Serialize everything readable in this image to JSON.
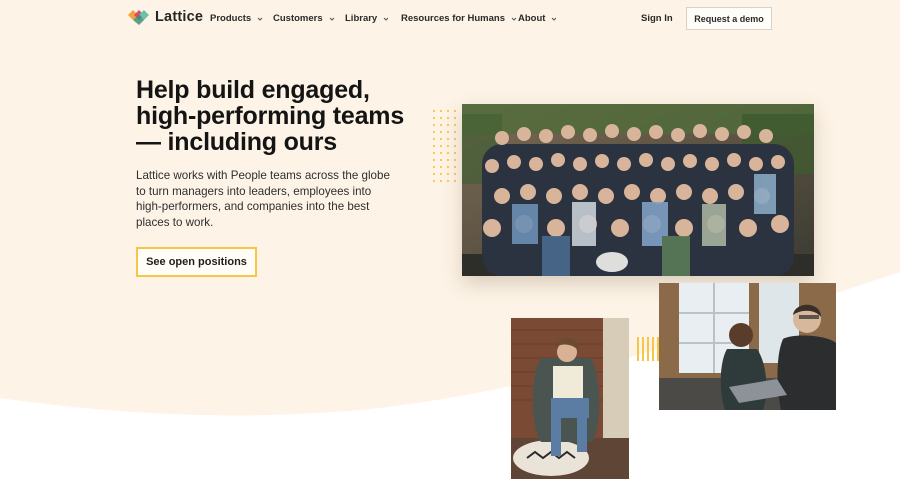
{
  "nav": {
    "logo_text": "Lattice",
    "menu": [
      "Products",
      "Customers",
      "Library",
      "Resources for Humans",
      "About"
    ],
    "sign_in": "Sign In",
    "demo_button": "Request a demo"
  },
  "hero": {
    "headline_lines": [
      "Help build engaged,",
      "high-performing teams",
      "— including ours"
    ],
    "subtext": "Lattice works with People teams across the globe to turn managers into leaders, employees into high-performers, and companies into the best places to work.",
    "cta": "See open positions"
  },
  "colors": {
    "hero_background": "#fdf3e6",
    "accent_yellow": "#f5c64a",
    "text_dark": "#141414"
  },
  "icons": {
    "logo": "lattice-logo-icon",
    "dropdown": "chevron-down-icon"
  }
}
